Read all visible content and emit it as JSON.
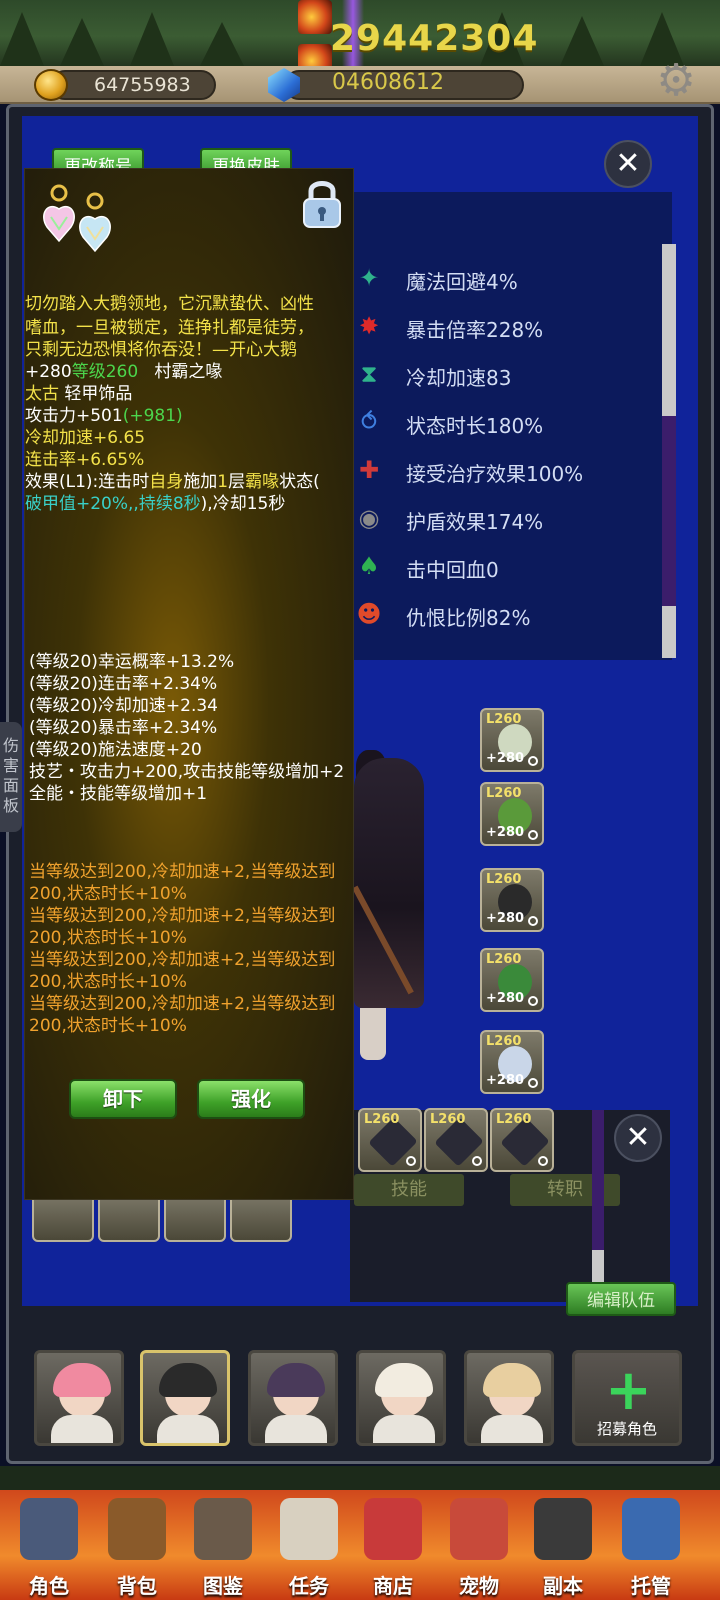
{
  "top": {
    "score": "29442304",
    "gold": "64755983",
    "gems": "04608612"
  },
  "tabs": {
    "change_title": "更改称号",
    "change_skin": "更换皮肤"
  },
  "stats": [
    {
      "icon": "magic-dodge-icon",
      "label": "魔法回避4%",
      "color": "#2fb38c"
    },
    {
      "icon": "crit-multiplier-icon",
      "label": "暴击倍率228%",
      "color": "#e02a2a"
    },
    {
      "icon": "cooldown-icon",
      "label": "冷却加速83",
      "color": "#2fb38c"
    },
    {
      "icon": "status-duration-icon",
      "label": "状态时长180%",
      "color": "#3f7fe0"
    },
    {
      "icon": "heal-received-icon",
      "label": "接受治疗效果100%",
      "color": "#d03a3a"
    },
    {
      "icon": "shield-icon",
      "label": "护盾效果174%",
      "color": "#8a8a8a"
    },
    {
      "icon": "lifesteal-icon",
      "label": "击中回血0",
      "color": "#2fb352"
    },
    {
      "icon": "aggro-icon",
      "label": "仇恨比例82%",
      "color": "#e04a2a"
    }
  ],
  "equipment": [
    {
      "level": "L260",
      "plus": "+280",
      "color": "#cfd9c0"
    },
    {
      "level": "L260",
      "plus": "+280",
      "color": "#5a9a3a"
    },
    {
      "level": "L260",
      "plus": "+280",
      "color": "#2a2a2a"
    },
    {
      "level": "L260",
      "plus": "+280",
      "color": "#3a8a3a"
    },
    {
      "level": "L260",
      "plus": "+280",
      "color": "#c9d6e8"
    }
  ],
  "weapon_slots": [
    {
      "level": "L260"
    },
    {
      "level": "L260"
    },
    {
      "level": "L260"
    }
  ],
  "side_tab": "伤害面板",
  "lower": {
    "skill": "技能",
    "job_change": "转职",
    "edit_team": "编辑队伍"
  },
  "recruit_label": "招募角色",
  "nav": [
    {
      "label": "角色",
      "icon": "character-icon",
      "color": "#4a5a7a"
    },
    {
      "label": "背包",
      "icon": "backpack-icon",
      "color": "#8a5a2a"
    },
    {
      "label": "图鉴",
      "icon": "book-icon",
      "color": "#6a5a4a"
    },
    {
      "label": "任务",
      "icon": "scroll-icon",
      "color": "#d8d0c0"
    },
    {
      "label": "商店",
      "icon": "shop-icon",
      "color": "#c83a3a"
    },
    {
      "label": "宠物",
      "icon": "pet-icon",
      "color": "#c84a3a"
    },
    {
      "label": "副本",
      "icon": "skull-icon",
      "color": "#3a3a3a"
    },
    {
      "label": "托管",
      "icon": "calendar-icon",
      "color": "#3a6ab0"
    }
  ],
  "tooltip": {
    "desc": [
      "切勿踏入大鹅领地，它沉默蛰伏、凶性",
      "嗜血，一旦被锁定，连挣扎都是徒劳，",
      "只剩无边恐惧将你吞没！—开心大鹅"
    ],
    "plus": "+280",
    "level": "等级260",
    "name": "村霸之喙",
    "quality": "太古",
    "type": "轻甲饰品",
    "atk_label": "攻击力+501",
    "atk_bonus": "(+981)",
    "cooldown": "冷却加速+6.65",
    "combo": "连击率+6.65%",
    "effect_1": "效果(L1):连击时",
    "effect_self": "自身",
    "effect_2": "施加",
    "effect_num": "1",
    "effect_3": "层",
    "effect_status": "霸喙",
    "effect_4": "状态(",
    "effect_line2a": "破甲值+20%,,持续8秒",
    "effect_line2b": "),冷却15秒",
    "affixes": [
      "(等级20)幸运概率+13.2%",
      "(等级20)连击率+2.34%",
      "(等级20)冷却加速+2.34",
      "(等级20)暴击率+2.34%",
      "(等级20)施法速度+20",
      "技艺・攻击力+200,攻击技能等级增加+2",
      "全能・技能等级增加+1"
    ],
    "set_bonus": [
      "当等级达到200,冷却加速+2,当等级达到",
      "200,状态时长+10%",
      "当等级达到200,冷却加速+2,当等级达到",
      "200,状态时长+10%",
      "当等级达到200,冷却加速+2,当等级达到",
      "200,状态时长+10%",
      "当等级达到200,冷却加速+2,当等级达到",
      "200,状态时长+10%"
    ],
    "unequip": "卸下",
    "enhance": "强化"
  }
}
